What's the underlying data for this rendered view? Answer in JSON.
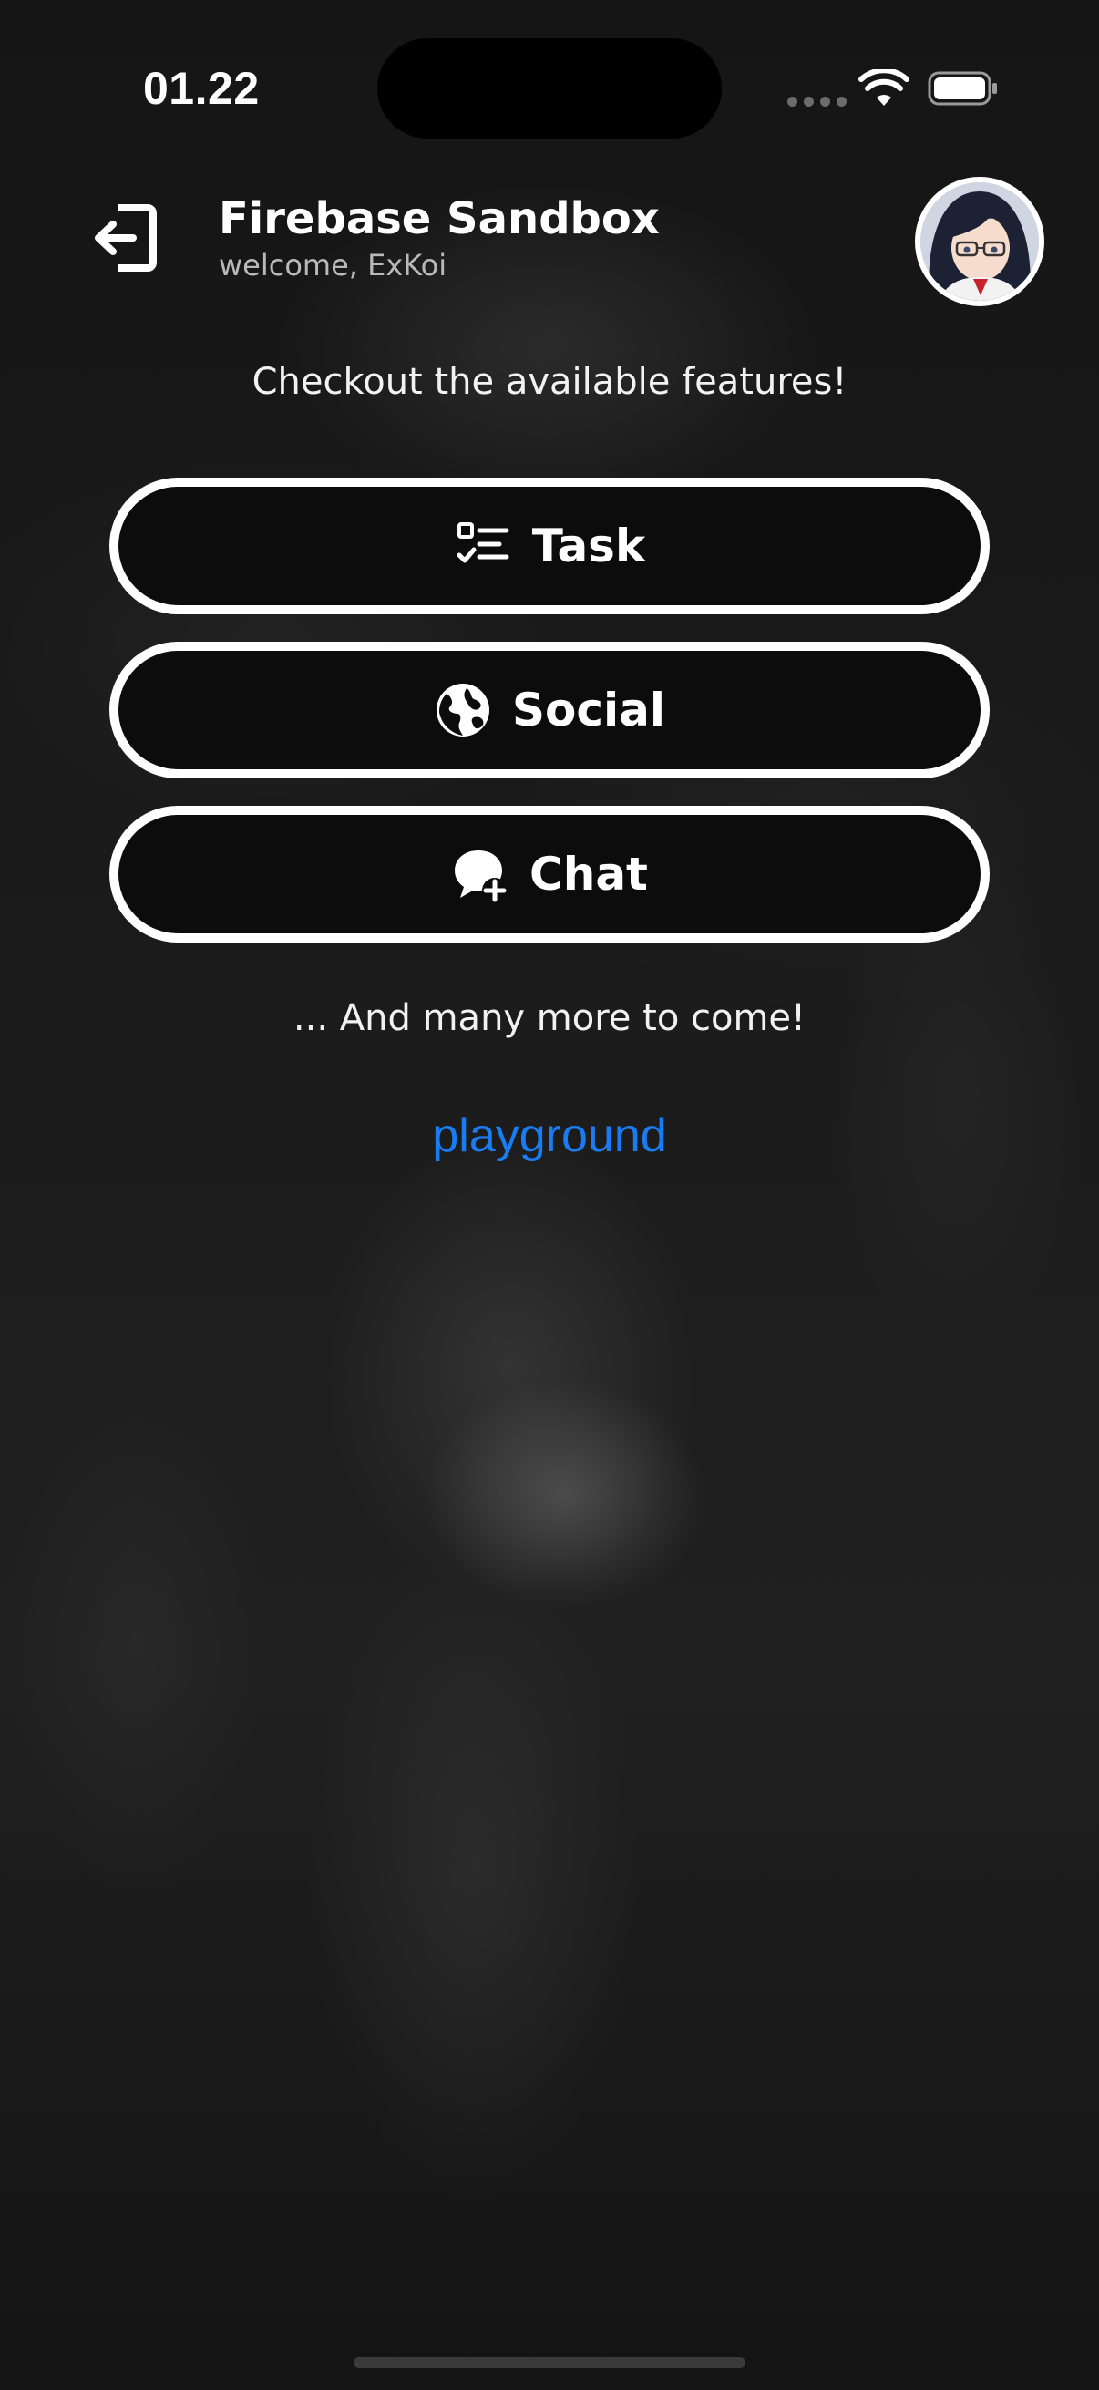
{
  "status_bar": {
    "time": "01.22",
    "icons": [
      "cellular-icon",
      "wifi-icon",
      "battery-icon"
    ]
  },
  "header": {
    "title": "Firebase Sandbox",
    "subtitle": "welcome, ExKoi",
    "logout_icon": "logout-icon",
    "avatar": "avatar"
  },
  "main": {
    "intro": "Checkout the available features!",
    "features": [
      {
        "label": "Task",
        "icon": "checklist-icon"
      },
      {
        "label": "Social",
        "icon": "globe-icon"
      },
      {
        "label": "Chat",
        "icon": "chat-add-icon"
      }
    ],
    "more": "... And many more to come!",
    "playground_link": "playground"
  },
  "colors": {
    "link": "#1a7cf2",
    "button_border": "#ffffff",
    "background": "#1a1a1a"
  }
}
